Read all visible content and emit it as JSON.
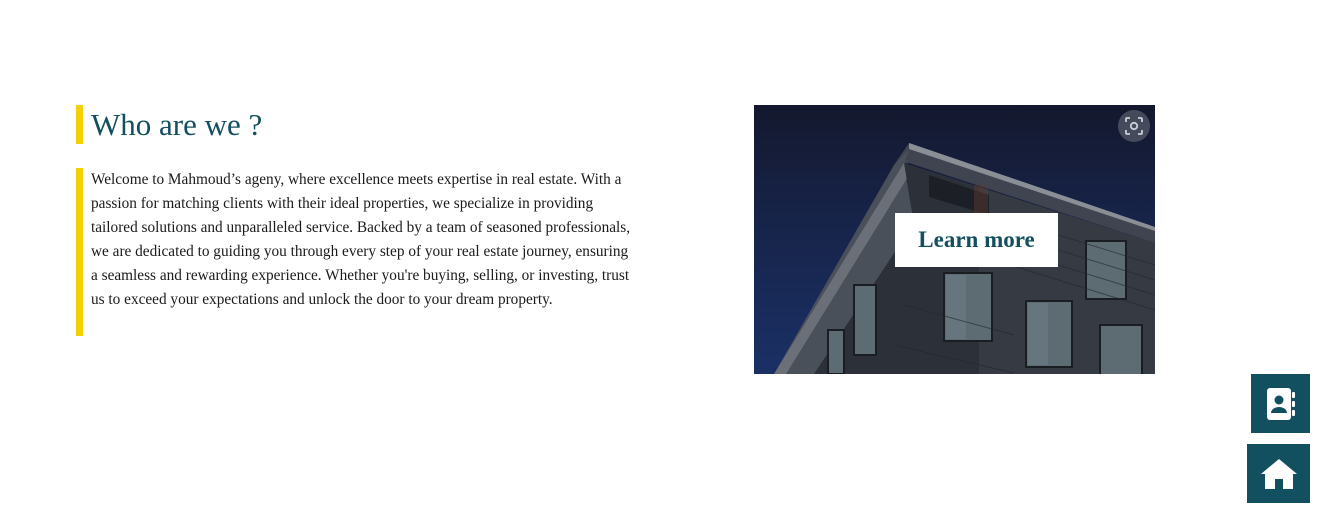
{
  "about": {
    "heading": "Who are we ?",
    "body": "Welcome to Mahmoud’s ageny, where excellence meets expertise in real estate. With a passion for matching clients with their ideal properties, we specialize in providing tailored solutions and unparalleled service. Backed by a team of seasoned professionals, we are dedicated to guiding you through every step of your real estate journey, ensuring a seamless and rewarding experience. Whether you're buying, selling, or investing, trust us to exceed your expectations and unlock the door to your dream property."
  },
  "hero_image": {
    "cta_label": "Learn more",
    "lens_icon": "visual-search-icon"
  },
  "floating_actions": {
    "contacts_icon": "contact-book-icon",
    "home_icon": "home-icon"
  },
  "colors": {
    "accent_bar": "#f5d000",
    "brand_teal": "#13505f",
    "text": "#1a1a1a"
  }
}
